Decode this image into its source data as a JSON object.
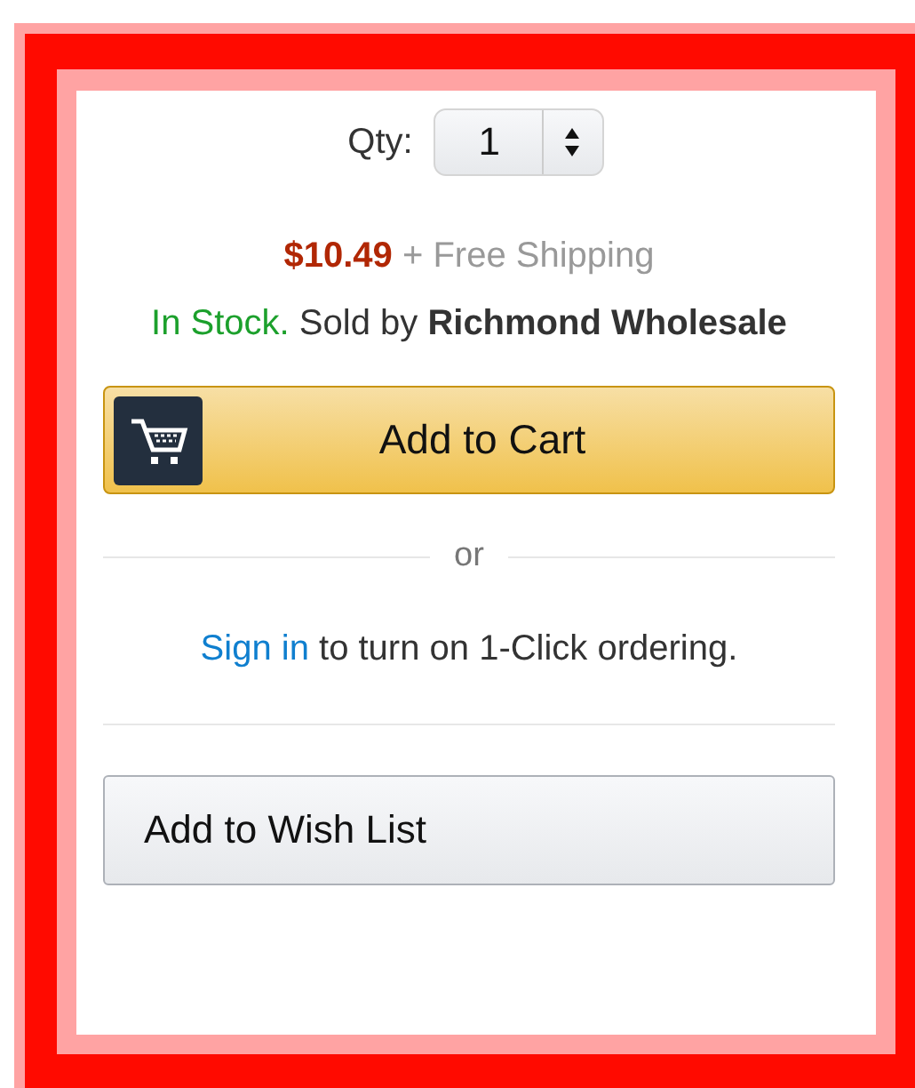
{
  "quantity": {
    "label": "Qty:",
    "value": "1"
  },
  "price": {
    "amount": "$10.49",
    "shipping": "+ Free Shipping"
  },
  "availability": {
    "status": "In Stock.",
    "seller": "Sold by **Richmond Wholesale**"
  },
  "add_to_cart": {
    "label": "Add to Cart"
  },
  "divider": {
    "label": "or"
  },
  "sign_in": {
    "link": "Sign in",
    "text": " to turn on 1-Click ordering."
  },
  "wish_list": {
    "label": "Add to Wish List"
  }
}
